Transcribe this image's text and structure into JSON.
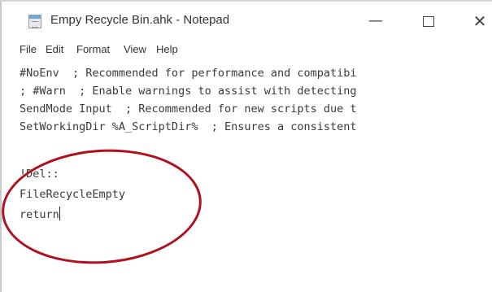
{
  "window": {
    "title": "Empy Recycle Bin.ahk - Notepad",
    "icon": "notepad-icon",
    "controls": {
      "minimize_glyph": "—",
      "close_glyph": "✕"
    }
  },
  "menu": {
    "items": [
      "File",
      "Edit",
      "Format",
      "View",
      "Help"
    ]
  },
  "editor": {
    "lines": [
      "#NoEnv  ; Recommended for performance and compatibi",
      "; #Warn  ; Enable warnings to assist with detecting",
      "SendMode Input  ; Recommended for new scripts due t",
      "SetWorkingDir %A_ScriptDir%  ; Ensures a consistent",
      "",
      "!Del::",
      "FileRecycleEmpty",
      "return"
    ]
  },
  "annotation": {
    "color": "#b0101c",
    "shape": "ellipse-highlight"
  }
}
